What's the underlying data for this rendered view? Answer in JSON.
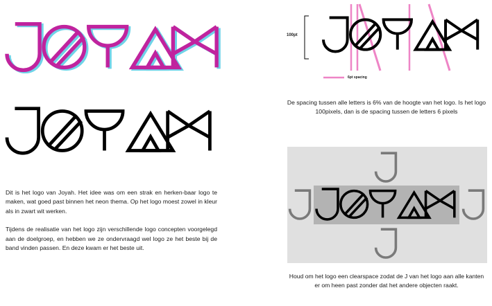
{
  "page": {
    "logo_text": "JOYAH",
    "colors": {
      "magenta": "#c0239e",
      "cyan": "#6fd3e8",
      "black": "#000000",
      "pink_guides": "#ee85c6",
      "clearspace_bg": "#e0e0e0",
      "inner_box": "#b3b3b3",
      "gray_j": "#7a7a7a"
    }
  },
  "left": {
    "paragraph_1": "Dit is het logo van Joyah. Het idee was om een strak en herken-baar logo te maken, wat goed past binnen het neon thema. Op het logo moest zowel in kleur als in zwart wit werken.",
    "paragraph_2": "Tijdens de realisatie van het  logo zijn verschillende logo concepten voorgelegd aan de doelgroep, en hebben we ze ondervraagd wel logo ze het beste bij de band vinden passen. En deze kwam er het beste uit."
  },
  "spacing": {
    "height_label": "100pt",
    "spacing_label": "6pt spacing",
    "caption": "De spacing tussen alle letters is 6% van de hoogte van het logo. Is het logo 100pixels, dan is de spacing tussen de letters 6 pixels"
  },
  "clearspace": {
    "guide_letter": "J",
    "caption": "Houd om het logo een clearspace zodat de J van het logo aan alle kanten er om heen past zonder dat het andere objecten raakt."
  }
}
